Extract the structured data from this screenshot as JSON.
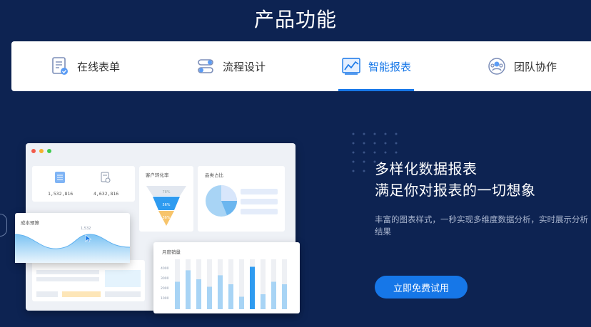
{
  "section_title": "产品功能",
  "tabs": [
    {
      "label": "在线表单",
      "icon": "form-document-icon"
    },
    {
      "label": "流程设计",
      "icon": "workflow-icon"
    },
    {
      "label": "智能报表",
      "icon": "line-chart-icon",
      "active": true
    },
    {
      "label": "团队协作",
      "icon": "team-icon"
    }
  ],
  "feature": {
    "heading_line1": "多样化数据报表",
    "heading_line2": "满足你对报表的一切想象",
    "description": "丰富的图表样式，一秒实现多维度数据分析，实时展示分析结果",
    "cta_label": "立即免费试用"
  },
  "mockup": {
    "stat1": "1,532,816",
    "stat2": "4,632,816",
    "conversion_title": "客户转化率",
    "category_title": "品类占比",
    "budget_title": "成本预算",
    "budget_marker": "1,532",
    "sales_title": "月度销量",
    "sales_axis": [
      "4000",
      "3000",
      "2000",
      "1000"
    ],
    "funnel_labels": [
      "78%",
      "56%",
      "36%"
    ]
  },
  "colors": {
    "background": "#0d2352",
    "accent": "#1677e8"
  }
}
